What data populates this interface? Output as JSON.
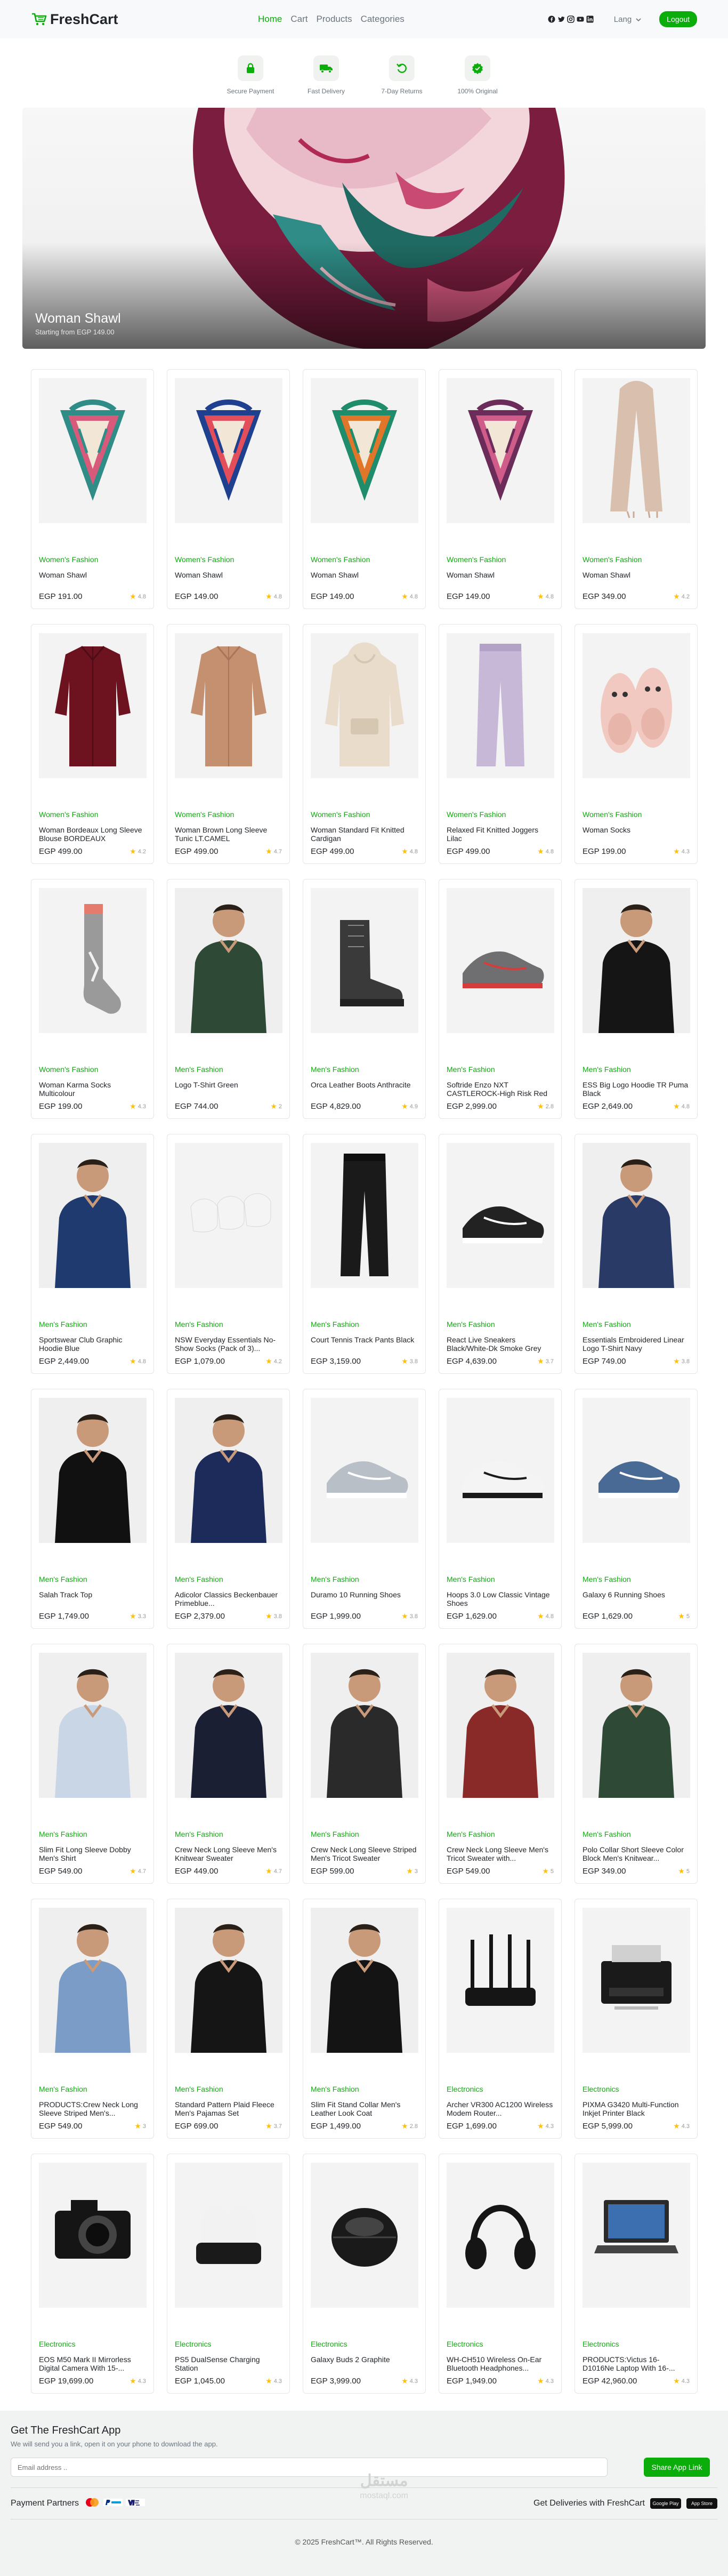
{
  "nav": {
    "brand": "FreshCart",
    "links": [
      {
        "label": "Home",
        "active": true
      },
      {
        "label": "Cart",
        "active": false
      },
      {
        "label": "Products",
        "active": false
      },
      {
        "label": "Categories",
        "active": false
      }
    ],
    "social_icons": [
      "facebook-icon",
      "twitter-icon",
      "instagram-icon",
      "youtube-icon",
      "linkedin-icon"
    ],
    "language": "Lang",
    "logout": "Logout"
  },
  "features": [
    {
      "icon": "lock-icon",
      "label": "Secure Payment"
    },
    {
      "icon": "truck-icon",
      "label": "Fast Delivery"
    },
    {
      "icon": "return-icon",
      "label": "7-Day Returns"
    },
    {
      "icon": "verified-icon",
      "label": "100% Original"
    }
  ],
  "hero": {
    "title": "Woman Shawl",
    "subtitle": "Starting from EGP 149.00"
  },
  "products": [
    {
      "category": "Women's Fashion",
      "name": "Woman Shawl",
      "price": "EGP 191.00",
      "rating": "4.8",
      "img": "scarf",
      "c1": "#2f8c86",
      "c2": "#d75a7a"
    },
    {
      "category": "Women's Fashion",
      "name": "Woman Shawl",
      "price": "EGP 149.00",
      "rating": "4.8",
      "img": "scarf",
      "c1": "#1f3f8f",
      "c2": "#e24f5a"
    },
    {
      "category": "Women's Fashion",
      "name": "Woman Shawl",
      "price": "EGP 149.00",
      "rating": "4.8",
      "img": "scarf",
      "c1": "#1f8c6b",
      "c2": "#e0762a"
    },
    {
      "category": "Women's Fashion",
      "name": "Woman Shawl",
      "price": "EGP 149.00",
      "rating": "4.8",
      "img": "scarf",
      "c1": "#6b2c5a",
      "c2": "#d05c8a"
    },
    {
      "category": "Women's Fashion",
      "name": "Woman Shawl",
      "price": "EGP 349.00",
      "rating": "4.2",
      "img": "longscarf",
      "c1": "#d9bfae",
      "c2": "#c9aa96"
    },
    {
      "category": "Women's Fashion",
      "name": "Woman Bordeaux Long Sleeve Blouse BORDEAUX",
      "price": "EGP 499.00",
      "rating": "4.2",
      "img": "shirt",
      "c1": "#6d1320",
      "c2": "#4e0c16"
    },
    {
      "category": "Women's Fashion",
      "name": "Woman Brown Long Sleeve Tunic LT.CAMEL",
      "price": "EGP 499.00",
      "rating": "4.7",
      "img": "shirt",
      "c1": "#c49070",
      "c2": "#a8755a"
    },
    {
      "category": "Women's Fashion",
      "name": "Woman Standard Fit Knitted Cardigan",
      "price": "EGP 499.00",
      "rating": "4.8",
      "img": "hoodie",
      "c1": "#e9dccb",
      "c2": "#d6c7b3"
    },
    {
      "category": "Women's Fashion",
      "name": "Relaxed Fit Knitted Joggers Lilac",
      "price": "EGP 499.00",
      "rating": "4.8",
      "img": "pants",
      "c1": "#c7b8d8",
      "c2": "#b3a2c7"
    },
    {
      "category": "Women's Fashion",
      "name": "Woman Socks",
      "price": "EGP 199.00",
      "rating": "4.3",
      "img": "slippers",
      "c1": "#f1c9c0",
      "c2": "#e8b5aa"
    },
    {
      "category": "Women's Fashion",
      "name": "Woman Karma Socks Multicolour",
      "price": "EGP 199.00",
      "rating": "4.3",
      "img": "sock",
      "c1": "#9a9a9a",
      "c2": "#e57b6c"
    },
    {
      "category": "Men's Fashion",
      "name": "Logo T-Shirt Green",
      "price": "EGP 744.00",
      "rating": "2",
      "img": "man",
      "c1": "#2e4a36",
      "c2": "#c99a7a"
    },
    {
      "category": "Men's Fashion",
      "name": "Orca Leather Boots Anthracite",
      "price": "EGP 4,829.00",
      "rating": "4.9",
      "img": "boot",
      "c1": "#3a3a3a",
      "c2": "#222222"
    },
    {
      "category": "Men's Fashion",
      "name": "Softride Enzo NXT CASTLEROCK-High Risk Red",
      "price": "EGP 2,999.00",
      "rating": "2.8",
      "img": "shoe",
      "c1": "#6f6f72",
      "c2": "#d63c3c"
    },
    {
      "category": "Men's Fashion",
      "name": "ESS Big Logo Hoodie TR Puma Black",
      "price": "EGP 2,649.00",
      "rating": "4.8",
      "img": "man",
      "c1": "#151515",
      "c2": "#c99a7a"
    },
    {
      "category": "Men's Fashion",
      "name": "Sportswear Club Graphic Hoodie Blue",
      "price": "EGP 2,449.00",
      "rating": "4.8",
      "img": "man",
      "c1": "#1f3a6e",
      "c2": "#c99a7a"
    },
    {
      "category": "Men's Fashion",
      "name": "NSW Everyday Essentials No-Show Socks (Pack of 3)...",
      "price": "EGP 1,079.00",
      "rating": "4.2",
      "img": "socks3",
      "c1": "#f4f4f4",
      "c2": "#d8d8d8"
    },
    {
      "category": "Men's Fashion",
      "name": "Court Tennis Track Pants Black",
      "price": "EGP 3,159.00",
      "rating": "3.8",
      "img": "pants",
      "c1": "#1a1a1a",
      "c2": "#0f0f0f"
    },
    {
      "category": "Men's Fashion",
      "name": "React Live Sneakers Black/White-Dk Smoke Grey",
      "price": "EGP 4,639.00",
      "rating": "3.7",
      "img": "shoe",
      "c1": "#222222",
      "c2": "#ffffff"
    },
    {
      "category": "Men's Fashion",
      "name": "Essentials Embroidered Linear Logo T-Shirt Navy",
      "price": "EGP 749.00",
      "rating": "3.8",
      "img": "man",
      "c1": "#2a3a66",
      "c2": "#c99a7a"
    },
    {
      "category": "Men's Fashion",
      "name": "Salah Track Top",
      "price": "EGP 1,749.00",
      "rating": "3.3",
      "img": "man",
      "c1": "#111111",
      "c2": "#c99a7a"
    },
    {
      "category": "Men's Fashion",
      "name": "Adicolor Classics Beckenbauer Primeblue...",
      "price": "EGP 2,379.00",
      "rating": "3.8",
      "img": "man",
      "c1": "#1c2b5a",
      "c2": "#c99a7a"
    },
    {
      "category": "Men's Fashion",
      "name": "Duramo 10 Running Shoes",
      "price": "EGP 1,999.00",
      "rating": "3.8",
      "img": "shoe",
      "c1": "#b8bfc7",
      "c2": "#ffffff"
    },
    {
      "category": "Men's Fashion",
      "name": "Hoops 3.0 Low Classic Vintage Shoes",
      "price": "EGP 1,629.00",
      "rating": "4.8",
      "img": "shoe",
      "c1": "#f4f4f4",
      "c2": "#1a1a1a"
    },
    {
      "category": "Men's Fashion",
      "name": "Galaxy 6 Running Shoes",
      "price": "EGP 1,629.00",
      "rating": "5",
      "img": "shoe",
      "c1": "#4a6a96",
      "c2": "#ffffff"
    },
    {
      "category": "Men's Fashion",
      "name": "Slim Fit Long Sleeve Dobby Men's Shirt",
      "price": "EGP 549.00",
      "rating": "4.7",
      "img": "man",
      "c1": "#c9d6e6",
      "c2": "#c99a7a"
    },
    {
      "category": "Men's Fashion",
      "name": "Crew Neck Long Sleeve Men's Knitwear Sweater",
      "price": "EGP 449.00",
      "rating": "4.7",
      "img": "man",
      "c1": "#1a1f33",
      "c2": "#c99a7a"
    },
    {
      "category": "Men's Fashion",
      "name": "Crew Neck Long Sleeve Striped Men's Tricot Sweater",
      "price": "EGP 599.00",
      "rating": "3",
      "img": "man",
      "c1": "#2a2a2a",
      "c2": "#c99a7a"
    },
    {
      "category": "Men's Fashion",
      "name": "Crew Neck Long Sleeve Men's Tricot Sweater with...",
      "price": "EGP 549.00",
      "rating": "5",
      "img": "man",
      "c1": "#8a2a28",
      "c2": "#c99a7a"
    },
    {
      "category": "Men's Fashion",
      "name": "Polo Collar Short Sleeve Color Block Men's Knitwear...",
      "price": "EGP 349.00",
      "rating": "5",
      "img": "man",
      "c1": "#2e4a36",
      "c2": "#c99a7a"
    },
    {
      "category": "Men's Fashion",
      "name": "PRODUCTS:Crew Neck Long Sleeve Striped Men's...",
      "price": "EGP 549.00",
      "rating": "3",
      "img": "man",
      "c1": "#7a9cc6",
      "c2": "#c99a7a"
    },
    {
      "category": "Men's Fashion",
      "name": "Standard Pattern Plaid Fleece Men's Pajamas Set",
      "price": "EGP 699.00",
      "rating": "3.7",
      "img": "man",
      "c1": "#151515",
      "c2": "#c99a7a"
    },
    {
      "category": "Men's Fashion",
      "name": "Slim Fit Stand Collar Men's Leather Look Coat",
      "price": "EGP 1,499.00",
      "rating": "2.8",
      "img": "man",
      "c1": "#141414",
      "c2": "#c99a7a"
    },
    {
      "category": "Electronics",
      "name": "Archer VR300 AC1200 Wireless Modem Router...",
      "price": "EGP 1,699.00",
      "rating": "4.3",
      "img": "router",
      "c1": "#151515",
      "c2": "#333333"
    },
    {
      "category": "Electronics",
      "name": "PIXMA G3420 Multi-Function Inkjet Printer Black",
      "price": "EGP 5,999.00",
      "rating": "4.3",
      "img": "printer",
      "c1": "#1a1a1a",
      "c2": "#d0d0d0"
    },
    {
      "category": "Electronics",
      "name": "EOS M50 Mark II Mirrorless Digital Camera With 15-...",
      "price": "EGP 19,699.00",
      "rating": "4.3",
      "img": "camera",
      "c1": "#151515",
      "c2": "#444444"
    },
    {
      "category": "Electronics",
      "name": "PS5 DualSense Charging Station",
      "price": "EGP 1,045.00",
      "rating": "4.3",
      "img": "controller",
      "c1": "#f2f2f2",
      "c2": "#1a1a1a"
    },
    {
      "category": "Electronics",
      "name": "Galaxy Buds 2 Graphite",
      "price": "EGP 3,999.00",
      "rating": "4.3",
      "img": "buds",
      "c1": "#1a1a1a",
      "c2": "#444444"
    },
    {
      "category": "Electronics",
      "name": "WH-CH510 Wireless On-Ear Bluetooth Headphones...",
      "price": "EGP 1,949.00",
      "rating": "4.3",
      "img": "headphones",
      "c1": "#151515",
      "c2": "#333333"
    },
    {
      "category": "Electronics",
      "name": "PRODUCTS:Victus 16-D1016Ne Laptop With 16-...",
      "price": "EGP 42,960.00",
      "rating": "4.3",
      "img": "laptop",
      "c1": "#2a2a2a",
      "c2": "#3b6fb0"
    }
  ],
  "app": {
    "title": "Get The FreshCart App",
    "subtitle": "We will send you a link, open it on your phone to download the app.",
    "email_placeholder": "Email address ..",
    "share_button": "Share App Link",
    "partners_label": "Payment Partners",
    "payment_icons": [
      "mastercard-icon",
      "paypal-icon",
      "visa-icon"
    ],
    "delivery_label": "Get Deliveries with FreshCart",
    "stores": [
      "Google Play",
      "App Store"
    ],
    "watermark": "مستقل",
    "watermark_sub": "mostaql.com"
  },
  "copyright": "© 2025 FreshCart™. All Rights Reserved."
}
